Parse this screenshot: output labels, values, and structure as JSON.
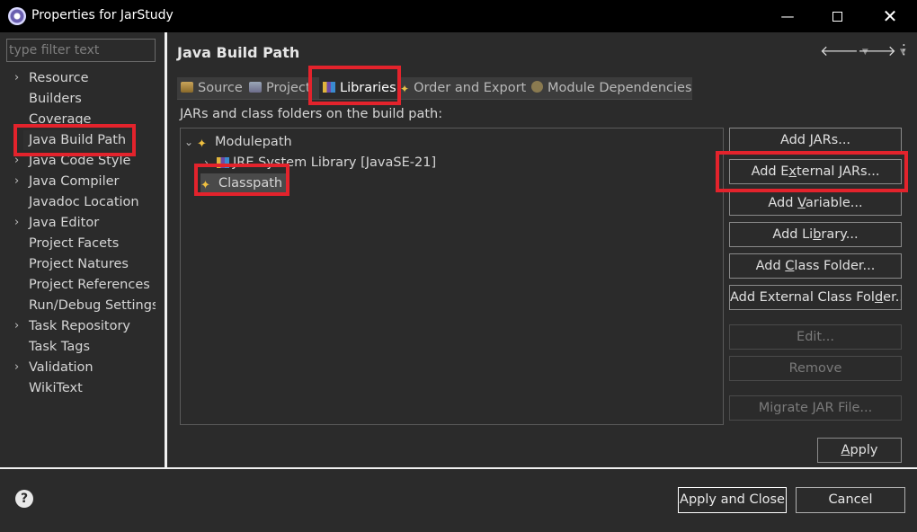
{
  "window": {
    "title": "Properties for JarStudy",
    "minimize": "—",
    "close": "✕"
  },
  "filter": {
    "placeholder": "type filter text"
  },
  "nav_tree": [
    {
      "label": "Resource",
      "expandable": true
    },
    {
      "label": "Builders",
      "expandable": false
    },
    {
      "label": "Coverage",
      "expandable": false
    },
    {
      "label": "Java Build Path",
      "expandable": false,
      "selected": true
    },
    {
      "label": "Java Code Style",
      "expandable": true
    },
    {
      "label": "Java Compiler",
      "expandable": true
    },
    {
      "label": "Javadoc Location",
      "expandable": false
    },
    {
      "label": "Java Editor",
      "expandable": true
    },
    {
      "label": "Project Facets",
      "expandable": false
    },
    {
      "label": "Project Natures",
      "expandable": false
    },
    {
      "label": "Project References",
      "expandable": false
    },
    {
      "label": "Run/Debug Settings",
      "expandable": false
    },
    {
      "label": "Task Repository",
      "expandable": true
    },
    {
      "label": "Task Tags",
      "expandable": false
    },
    {
      "label": "Validation",
      "expandable": true
    },
    {
      "label": "WikiText",
      "expandable": false
    }
  ],
  "page": {
    "title": "Java Build Path",
    "tabs": [
      {
        "label": "Source",
        "icon": "source-folder-icon"
      },
      {
        "label": "Project",
        "icon": "project-icon"
      },
      {
        "label": "Libraries",
        "icon": "libraries-icon",
        "active": true
      },
      {
        "label": "Order and Export",
        "icon": "order-export-icon"
      },
      {
        "label": "Module Dependencies",
        "icon": "module-icon"
      }
    ],
    "description": "JARs and class folders on the build path:",
    "tree": {
      "modulepath": "Modulepath",
      "jre": "JRE System Library [JavaSE-21]",
      "classpath": "Classpath"
    },
    "buttons": {
      "add_jars": {
        "pre": "Add ",
        "u": "J",
        "post": "ARs..."
      },
      "add_external_jars": {
        "pre": "Add E",
        "u": "x",
        "post": "ternal JARs..."
      },
      "add_variable": {
        "pre": "Add ",
        "u": "V",
        "post": "ariable..."
      },
      "add_library": {
        "pre": "Add Li",
        "u": "b",
        "post": "rary..."
      },
      "add_class_folder": {
        "pre": "Add ",
        "u": "C",
        "post": "lass Folder..."
      },
      "add_external_class_folder": {
        "pre": "Add External Class Fol",
        "u": "d",
        "post": "er..."
      },
      "edit": "Edit...",
      "remove": "Remove",
      "migrate": "Migrate JAR File...",
      "apply": {
        "u": "A",
        "post": "pply"
      }
    }
  },
  "footer": {
    "help": "?",
    "apply_and_close": "Apply and Close",
    "cancel": "Cancel"
  },
  "colors": {
    "highlight": "#e3232c",
    "background": "#2b2b2b"
  }
}
